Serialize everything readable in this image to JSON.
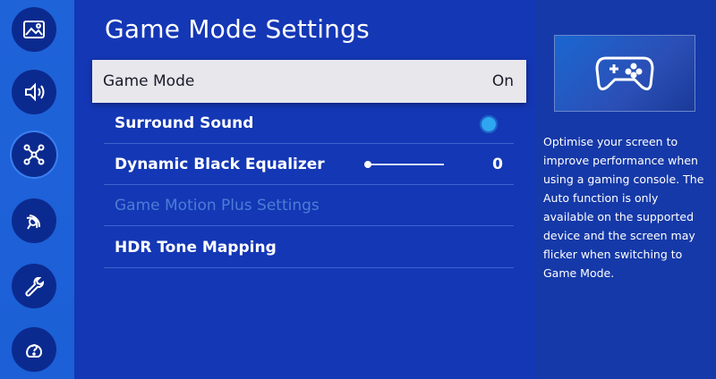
{
  "sidebar": {
    "items": [
      {
        "icon": "picture-icon"
      },
      {
        "icon": "sound-icon"
      },
      {
        "icon": "network-icon"
      },
      {
        "icon": "broadcast-icon"
      },
      {
        "icon": "wrench-icon"
      },
      {
        "icon": "support-icon"
      }
    ]
  },
  "main": {
    "title": "Game Mode Settings",
    "rows": [
      {
        "label": "Game Mode",
        "value": "On"
      },
      {
        "label": "Surround Sound"
      },
      {
        "label": "Dynamic Black Equalizer",
        "value": "0",
        "slider_level": 0
      },
      {
        "label": "Game Motion Plus Settings"
      },
      {
        "label": "HDR Tone Mapping"
      }
    ]
  },
  "info": {
    "preview_icon": "gamepad-icon",
    "description": "Optimise your screen to improve performance when using a gaming console. The Auto function is only available on the supported device and the screen may flicker when switching to Game Mode."
  },
  "colors": {
    "background": "#1437b5",
    "sidebar": "#1f63d9",
    "selected_row": "#e7e7ec",
    "toggle_on": "#2fa6f2",
    "disabled_text": "#4b7ed6"
  }
}
